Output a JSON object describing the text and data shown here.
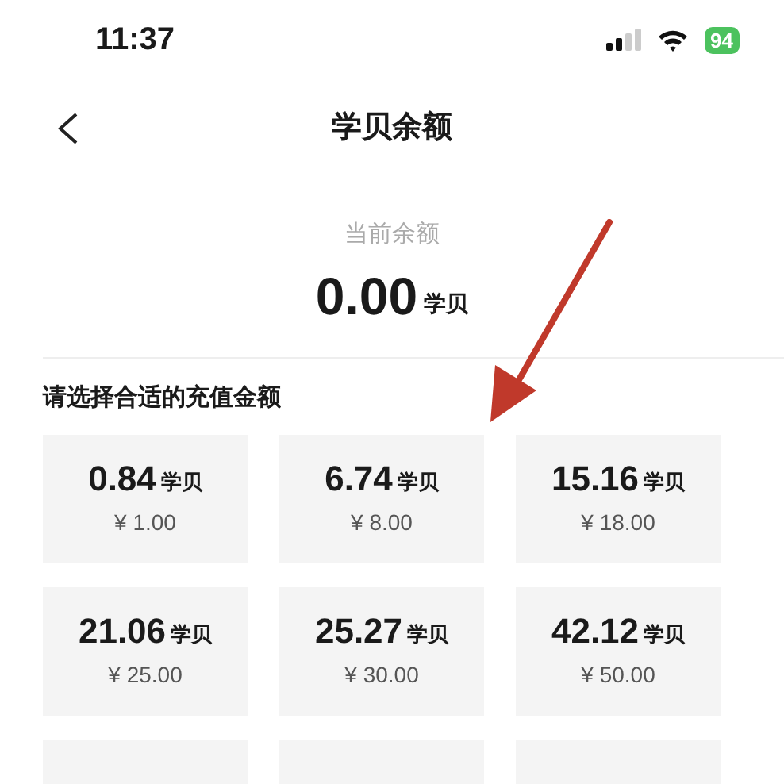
{
  "status_bar": {
    "time": "11:37",
    "battery": "94"
  },
  "nav": {
    "title": "学贝余额"
  },
  "balance": {
    "label": "当前余额",
    "amount": "0.00",
    "unit": "学贝"
  },
  "section_title": "请选择合适的充值金额",
  "options": [
    {
      "amount": "0.84",
      "unit": "学贝",
      "price": "¥ 1.00"
    },
    {
      "amount": "6.74",
      "unit": "学贝",
      "price": "¥ 8.00"
    },
    {
      "amount": "15.16",
      "unit": "学贝",
      "price": "¥ 18.00"
    },
    {
      "amount": "21.06",
      "unit": "学贝",
      "price": "¥ 25.00"
    },
    {
      "amount": "25.27",
      "unit": "学贝",
      "price": "¥ 30.00"
    },
    {
      "amount": "42.12",
      "unit": "学贝",
      "price": "¥ 50.00"
    }
  ]
}
